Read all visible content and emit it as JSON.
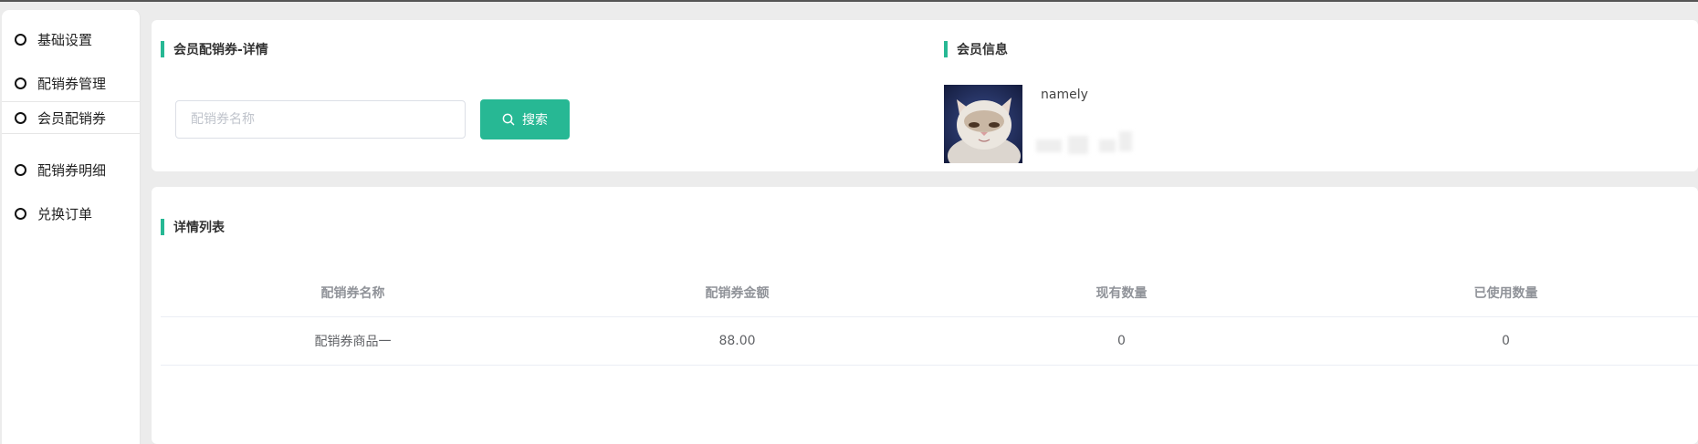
{
  "sidebar": {
    "items": [
      {
        "label": "基础设置"
      },
      {
        "label": "配销券管理"
      },
      {
        "label": "会员配销券"
      },
      {
        "label": "配销券明细"
      },
      {
        "label": "兑换订单"
      }
    ]
  },
  "detail": {
    "title": "会员配销券-详情",
    "search": {
      "placeholder": "配销券名称",
      "value": "",
      "button_label": "搜索"
    }
  },
  "member": {
    "title": "会员信息",
    "name": "namely"
  },
  "list": {
    "title": "详情列表",
    "columns": [
      "配销券名称",
      "配销券金额",
      "现有数量",
      "已使用数量"
    ],
    "rows": [
      [
        "配销券商品一",
        "88.00",
        "0",
        "0"
      ]
    ]
  },
  "colors": {
    "accent": "#27b894",
    "text": "#333333",
    "muted": "#909399"
  },
  "icons": {
    "search": "search-icon",
    "nav": "circle-bullet-icon"
  }
}
